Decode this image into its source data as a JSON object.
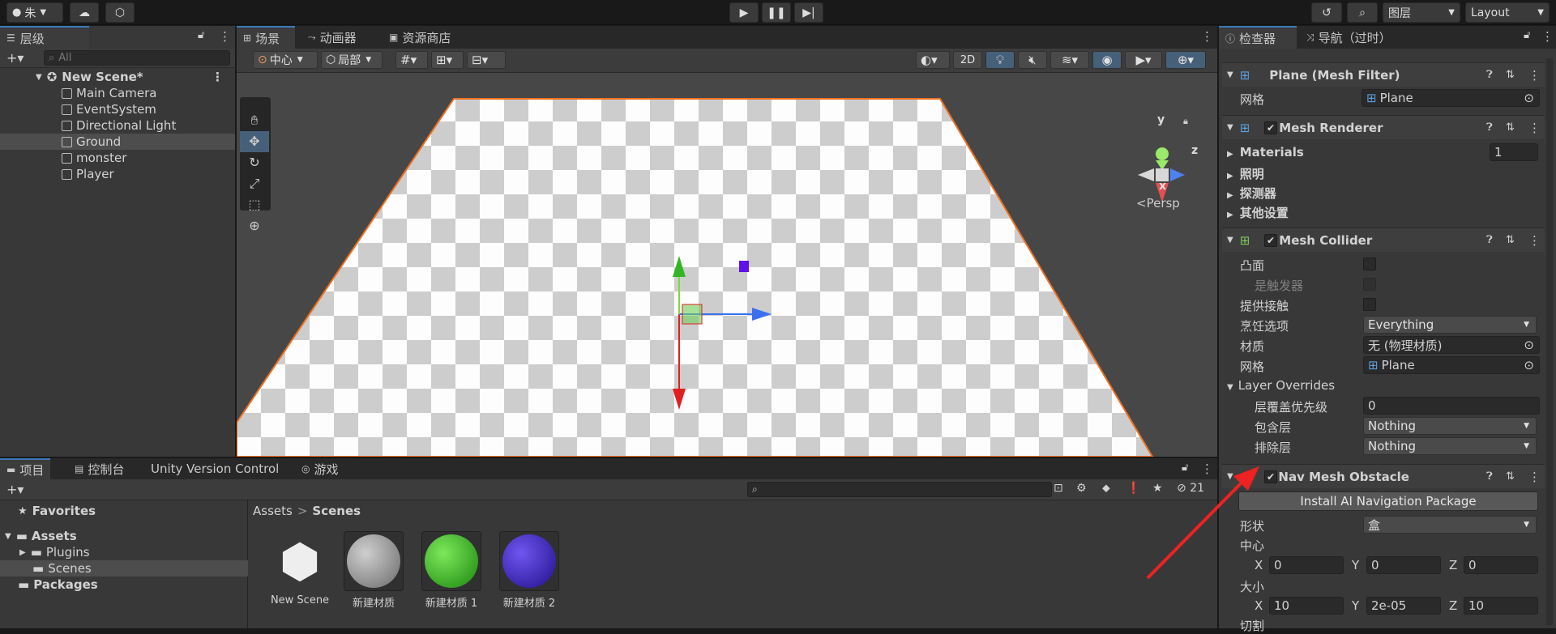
{
  "toolbar": {
    "account_label": "朱",
    "layers_label": "图层",
    "layout_label": "Layout"
  },
  "hierarchy": {
    "tab_label": "层级",
    "search_placeholder": "All",
    "scene_name": "New Scene*",
    "items": [
      {
        "label": "Main Camera"
      },
      {
        "label": "EventSystem"
      },
      {
        "label": "Directional Light"
      },
      {
        "label": "Ground"
      },
      {
        "label": "monster"
      },
      {
        "label": "Player"
      }
    ]
  },
  "scene_view": {
    "tabs": [
      {
        "label": "场景"
      },
      {
        "label": "动画器"
      },
      {
        "label": "资源商店"
      }
    ],
    "pivot_label": "中心",
    "space_label": "局部",
    "mode_2d": "2D",
    "gizmo": {
      "y": "y",
      "z": "z",
      "x": "x",
      "persp": "Persp"
    }
  },
  "bottom": {
    "tabs": [
      {
        "label": "项目"
      },
      {
        "label": "控制台"
      },
      {
        "label": "Unity Version Control"
      },
      {
        "label": "游戏"
      }
    ],
    "hidden_count": "21",
    "tree": {
      "favorites": "Favorites",
      "assets": "Assets",
      "plugins": "Plugins",
      "scenes": "Scenes",
      "packages": "Packages"
    },
    "breadcrumb": {
      "root": "Assets",
      "current": "Scenes"
    },
    "assets": [
      {
        "label": "New Scene"
      },
      {
        "label": "新建材质"
      },
      {
        "label": "新建材质 1"
      },
      {
        "label": "新建材质 2"
      }
    ]
  },
  "inspector": {
    "tab_label": "检查器",
    "nav_tab_label": "导航（过时）",
    "mesh_filter": {
      "title": "Plane (Mesh Filter)",
      "mesh_label": "网格",
      "mesh_value": "Plane"
    },
    "mesh_renderer": {
      "title": "Mesh Renderer",
      "materials_label": "Materials",
      "materials_count": "1",
      "lighting": "照明",
      "probes": "探测器",
      "other": "其他设置"
    },
    "mesh_collider": {
      "title": "Mesh Collider",
      "convex": "凸面",
      "is_trigger": "是触发器",
      "provides_contacts": "提供接触",
      "cooking_options": "烹饪选项",
      "cooking_value": "Everything",
      "material_label": "材质",
      "material_value": "无 (物理材质)",
      "mesh_label": "网格",
      "mesh_value": "Plane",
      "layer_overrides": "Layer Overrides",
      "priority_label": "层覆盖优先级",
      "priority_value": "0",
      "include_label": "包含层",
      "include_value": "Nothing",
      "exclude_label": "排除层",
      "exclude_value": "Nothing"
    },
    "nav_mesh_obstacle": {
      "title": "Nav Mesh Obstacle",
      "install_button": "Install AI Navigation Package",
      "shape_label": "形状",
      "shape_value": "盒",
      "center_label": "中心",
      "center": {
        "x": "0",
        "y": "0",
        "z": "0"
      },
      "size_label": "大小",
      "size": {
        "x": "10",
        "y": "2e-05",
        "z": "10"
      },
      "carve_label": "切割",
      "axis_x": "X",
      "axis_y": "Y",
      "axis_z": "Z"
    }
  },
  "colors": {
    "accent": "#3a79bb",
    "selection": "#4d4d4d",
    "arrow": "#ee2222"
  }
}
